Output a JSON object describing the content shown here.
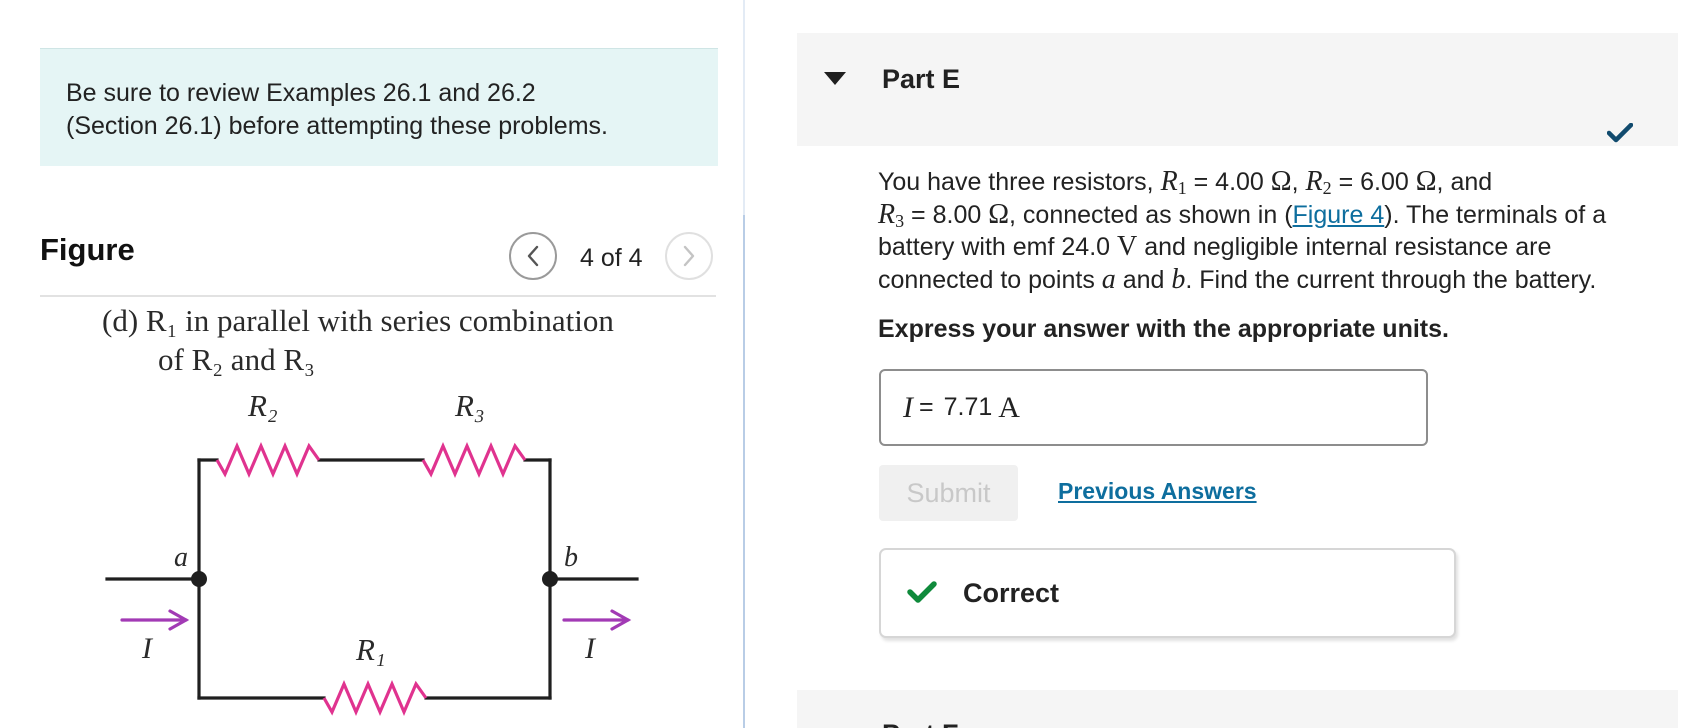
{
  "notice": {
    "line1": "Be sure to review Examples 26.1 and 26.2",
    "line2": "(Section 26.1) before attempting these problems."
  },
  "figure": {
    "title": "Figure",
    "counter": "4 of 4",
    "caption_line1": "(d) R₁ in parallel with series combination",
    "caption_line2": "of R₂ and R₃",
    "labels": {
      "r2": "R₂",
      "r3": "R₃",
      "r1": "R₁",
      "node_a": "a",
      "node_b": "b",
      "current_in": "I",
      "current_out": "I"
    },
    "colors": {
      "resistor": "#e0338f",
      "arrow": "#a23ab5",
      "wire": "#1f1f1f"
    }
  },
  "part": {
    "title": "Part E",
    "next_title": "Part F",
    "question": {
      "t1": "You have three resistors, ",
      "r1": "R",
      "r1_sub": "1",
      "r1_val": " = 4.00 ",
      "ohm": "Ω",
      "comma": ",",
      "r2": "R",
      "r2_sub": "2",
      "r2_val": " = 6.00 ",
      "and": ", and",
      "r3": "R",
      "r3_sub": "3",
      "r3_val": " = 8.00 ",
      "t2": ", connected as shown in (",
      "link": "Figure 4",
      "t3": "). The terminals of a",
      "t4": "battery with emf 24.0 ",
      "volt": "V",
      "t5": " and negligible internal resistance are",
      "t6": "connected to points ",
      "pt_a": "a",
      "t7": " and ",
      "pt_b": "b",
      "t8": ". Find the current through the battery."
    },
    "instruction": "Express your answer with the appropriate units.",
    "answer": {
      "variable": "I",
      "equals": "=",
      "value": "7.71",
      "unit": "A"
    },
    "submit_label": "Submit",
    "previous_answers_label": "Previous Answers",
    "feedback": "Correct"
  },
  "colors": {
    "link": "#0e6e9e",
    "correct_green": "#0f8a3b",
    "check_blue": "#114b6e",
    "notice_bg": "#e5f5f5"
  }
}
